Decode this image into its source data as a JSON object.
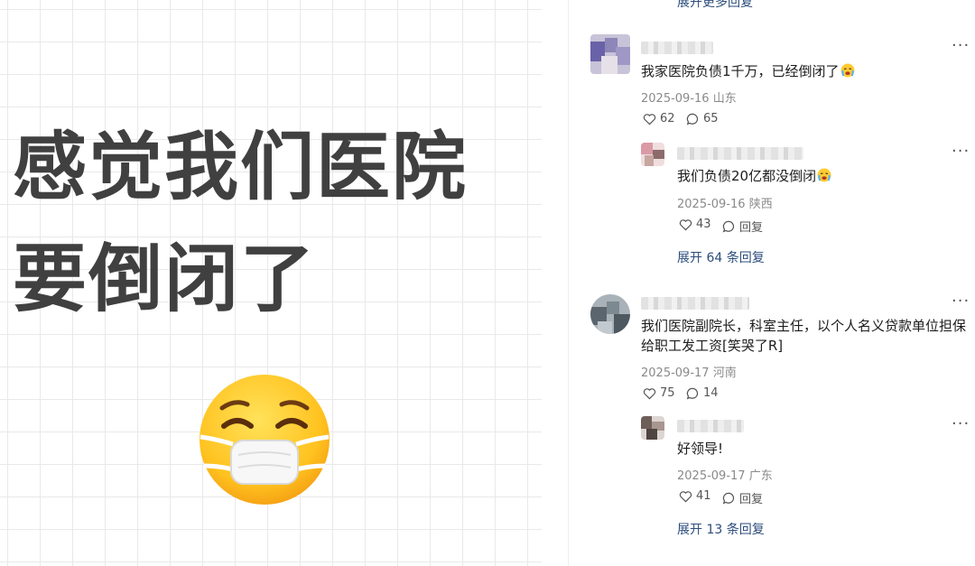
{
  "poster": {
    "title_line1": "感觉我们医院",
    "title_line2": "要倒闭了",
    "emoji_icon": "face-with-medical-mask"
  },
  "top_more": "展开更多回复",
  "comments": [
    {
      "text": "我家医院负债1千万，已经倒闭了",
      "emoji_icon": "crying-face",
      "date": "2025-09-16",
      "region": "山东",
      "likes": "62",
      "replies": "65",
      "reply": {
        "text": "我们负债20亿都没倒闭",
        "emoji_icon": "crying-face",
        "date": "2025-09-16",
        "region": "陕西",
        "likes": "43",
        "reply_label": "回复"
      },
      "expand": {
        "prefix": "展开",
        "count": "64",
        "suffix": "条回复"
      }
    },
    {
      "text_line1": "我们医院副院长，科室主任，以个人名义贷款单位担保",
      "text_line2": "给职工发工资[笑哭了R]",
      "date": "2025-09-17",
      "region": "河南",
      "likes": "75",
      "replies": "14",
      "reply": {
        "text": "好领导!",
        "date": "2025-09-17",
        "region": "广东",
        "likes": "41",
        "reply_label": "回复"
      },
      "expand": {
        "prefix": "展开",
        "count": "13",
        "suffix": "条回复"
      }
    }
  ],
  "colors": {
    "link": "#2c4d7c",
    "meta": "#8a8a8a",
    "poster_text": "#404040"
  }
}
